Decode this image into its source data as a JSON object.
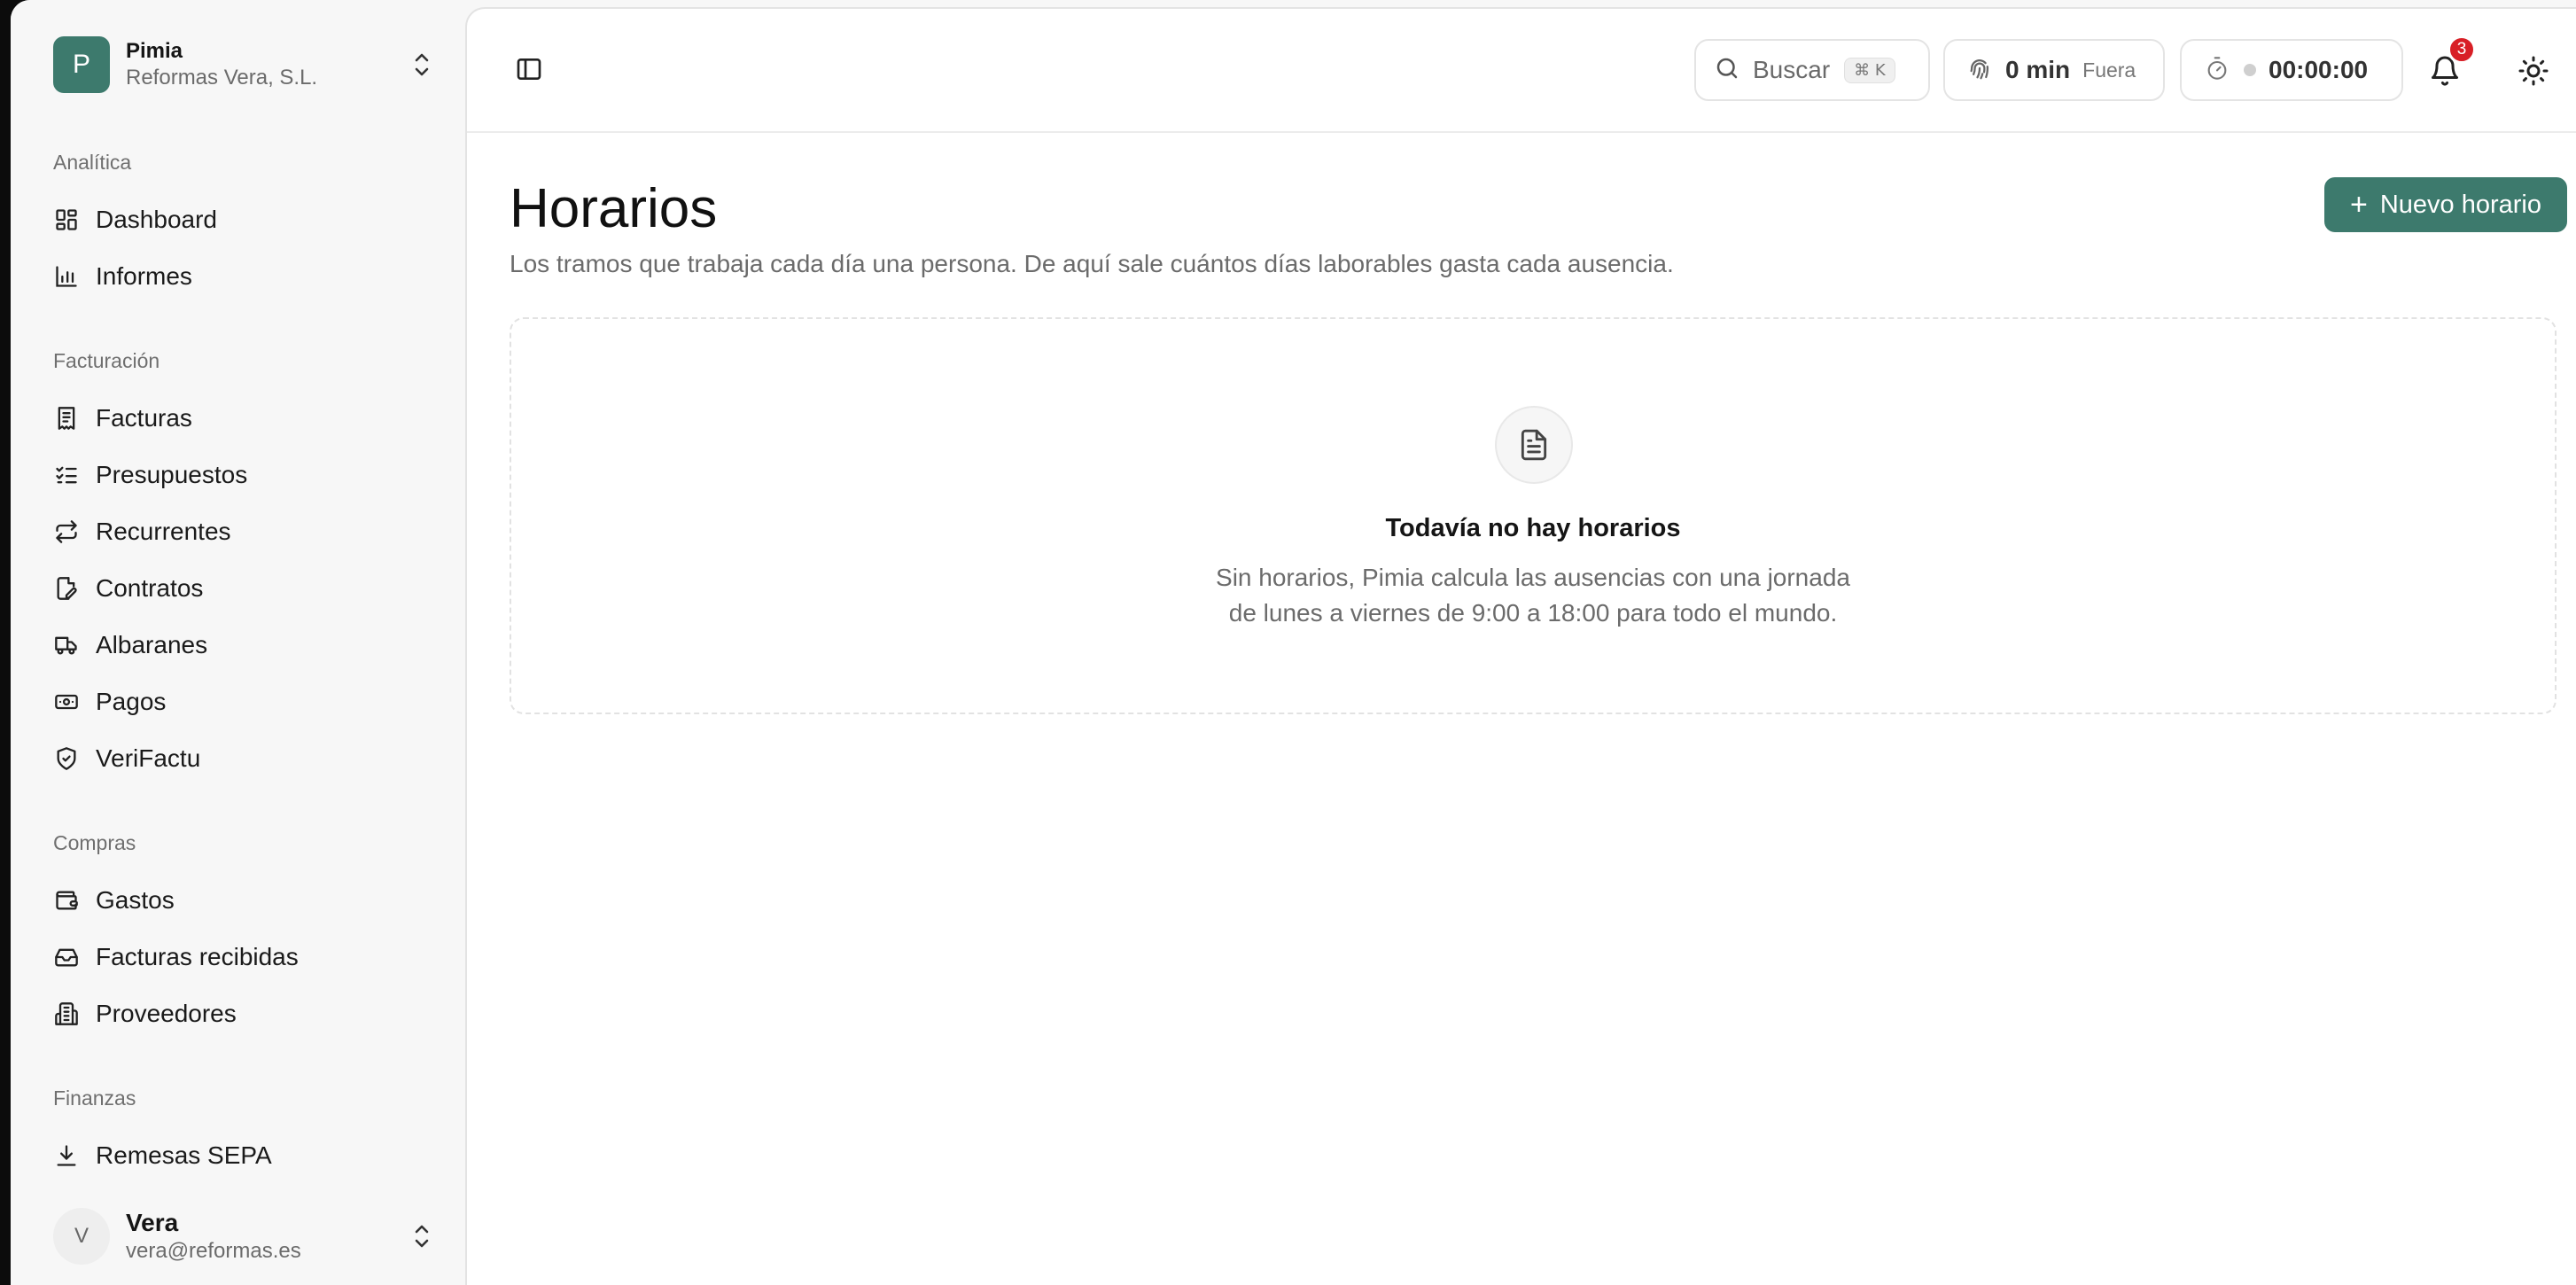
{
  "org": {
    "avatar": "P",
    "name": "Pimia",
    "subtitle": "Reformas Vera, S.L."
  },
  "nav": {
    "sections": [
      {
        "label": "Analítica",
        "items": [
          {
            "label": "Dashboard",
            "icon": "layout-dashboard-icon"
          },
          {
            "label": "Informes",
            "icon": "bar-chart-icon"
          }
        ]
      },
      {
        "label": "Facturación",
        "items": [
          {
            "label": "Facturas",
            "icon": "receipt-icon"
          },
          {
            "label": "Presupuestos",
            "icon": "list-checks-icon"
          },
          {
            "label": "Recurrentes",
            "icon": "repeat-icon"
          },
          {
            "label": "Contratos",
            "icon": "file-signature-icon"
          },
          {
            "label": "Albaranes",
            "icon": "truck-icon"
          },
          {
            "label": "Pagos",
            "icon": "banknote-icon"
          },
          {
            "label": "VeriFactu",
            "icon": "shield-check-icon"
          }
        ]
      },
      {
        "label": "Compras",
        "items": [
          {
            "label": "Gastos",
            "icon": "wallet-icon"
          },
          {
            "label": "Facturas recibidas",
            "icon": "inbox-icon"
          },
          {
            "label": "Proveedores",
            "icon": "building-icon"
          }
        ]
      },
      {
        "label": "Finanzas",
        "items": [
          {
            "label": "Remesas SEPA",
            "icon": "download-icon"
          }
        ]
      }
    ]
  },
  "user": {
    "avatar": "V",
    "name": "Vera",
    "email": "vera@reformas.es"
  },
  "topbar": {
    "search_label": "Buscar",
    "search_shortcut": "⌘ K",
    "clock_value": "0 min",
    "clock_status": "Fuera",
    "timer_value": "00:00:00",
    "notifications_count": "3"
  },
  "page": {
    "title": "Horarios",
    "description": "Los tramos que trabaja cada día una persona. De aquí sale cuántos días laborables gasta cada ausencia.",
    "new_button": "Nuevo horario",
    "empty_title": "Todavía no hay horarios",
    "empty_line1": "Sin horarios, Pimia calcula las ausencias con una jornada",
    "empty_line2": "de lunes a viernes de 9:00 a 18:00 para todo el mundo."
  },
  "colors": {
    "accent": "#3d7a6d",
    "badge": "#d81f26"
  }
}
